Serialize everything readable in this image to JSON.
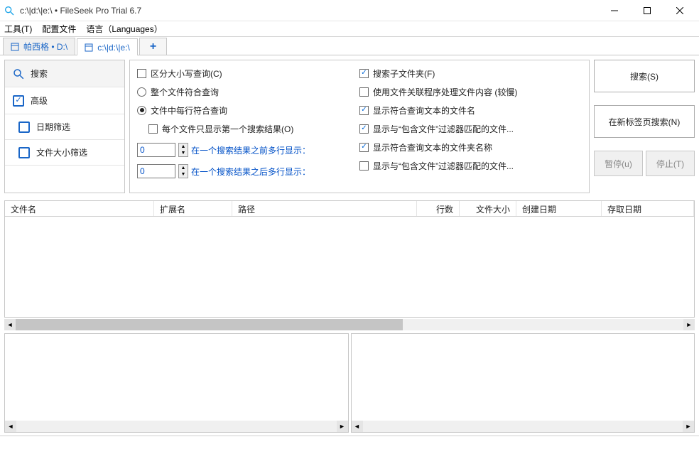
{
  "window": {
    "title": "c:\\|d:\\|e:\\ • FileSeek Pro Trial 6.7"
  },
  "menu": {
    "tools": "工具(T)",
    "profiles": "配置文件",
    "language": "语言（Languages）"
  },
  "tabs": {
    "tab1": "帕西格 • D:\\",
    "tab2": "c:\\|d:\\|e:\\"
  },
  "sidebar": {
    "search": "搜索",
    "advanced": "高级",
    "date_filter": "日期筛选",
    "size_filter": "文件大小筛选"
  },
  "options_left": {
    "case_sensitive": "区分大小写查询(C)",
    "whole_file": "整个文件符合查询",
    "each_line": "文件中每行符合查询",
    "first_only": "每个文件只显示第一个搜索结果(O)",
    "before_val": "0",
    "before_label": "在一个搜索结果之前多行显示：",
    "after_val": "0",
    "after_label": "在一个搜索结果之后多行显示："
  },
  "options_right": {
    "subfolders": "搜索子文件夹(F)",
    "file_handler": "使用文件关联程序处理文件内容 (较慢)",
    "show_filename": "显示符合查询文本的文件名",
    "show_include_files": "显示与“包含文件”过滤器匹配的文件...",
    "show_foldername": "显示符合查询文本的文件夹名称",
    "show_include_folders": "显示与“包含文件”过滤器匹配的文件..."
  },
  "buttons": {
    "search": "搜索(S)",
    "new_tab": "在新标签页搜索(N)",
    "pause": "暂停(u)",
    "stop": "停止(T)"
  },
  "columns": {
    "filename": "文件名",
    "ext": "扩展名",
    "path": "路径",
    "lines": "行数",
    "size": "文件大小",
    "created": "创建日期",
    "accessed": "存取日期"
  }
}
